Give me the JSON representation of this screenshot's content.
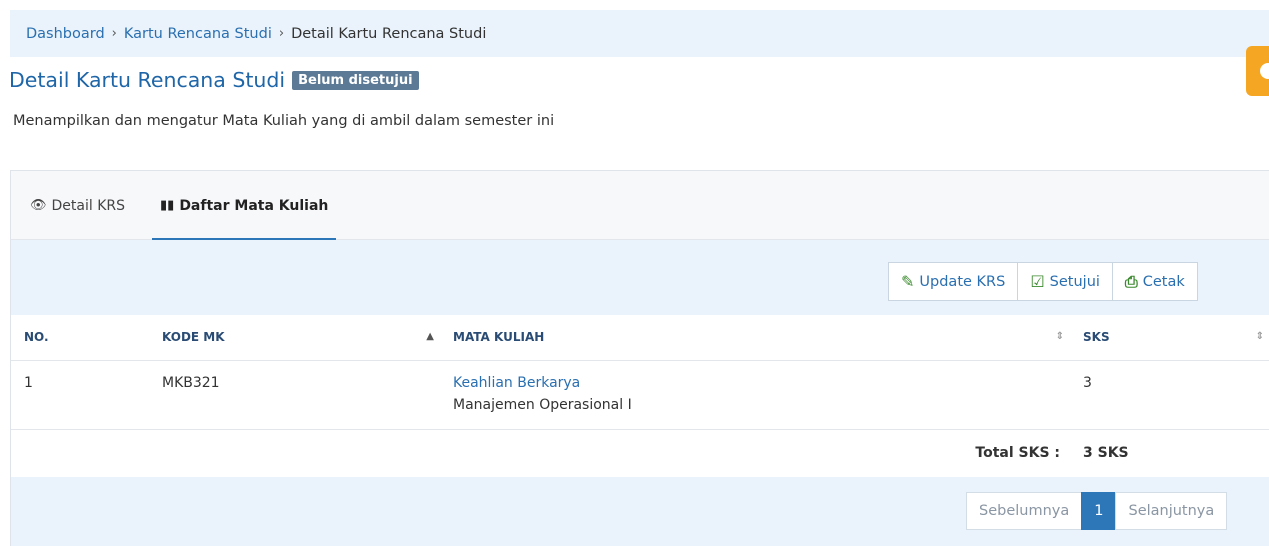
{
  "breadcrumb": {
    "items": [
      "Dashboard",
      "Kartu Rencana Studi"
    ],
    "current": "Detail Kartu Rencana Studi",
    "separator": "›"
  },
  "page": {
    "title": "Detail Kartu Rencana Studi",
    "status_badge": "Belum disetujui",
    "subtitle": "Menampilkan dan mengatur Mata Kuliah yang di ambil dalam semester ini"
  },
  "tabs": [
    {
      "label": "Detail KRS",
      "icon": "eye-icon",
      "active": false
    },
    {
      "label": "Daftar Mata Kuliah",
      "icon": "books-icon",
      "active": true
    }
  ],
  "toolbar": {
    "update_label": "Update KRS",
    "approve_label": "Setujui",
    "print_label": "Cetak"
  },
  "table": {
    "headers": [
      "NO.",
      "KODE MK",
      "MATA KULIAH",
      "SKS"
    ],
    "rows": [
      {
        "no": "1",
        "kode": "MKB321",
        "kelompok": "Keahlian Berkarya",
        "nama": "Manajemen Operasional I",
        "sks": "3"
      }
    ],
    "total_label": "Total SKS :",
    "total_value": "3 SKS"
  },
  "pagination": {
    "prev": "Sebelumnya",
    "page": "1",
    "next": "Selanjutnya"
  },
  "colors": {
    "primary": "#2d77b9",
    "accent_orange": "#f5a623",
    "icon_green": "#3b8a2e",
    "badge": "#5c7a96"
  }
}
